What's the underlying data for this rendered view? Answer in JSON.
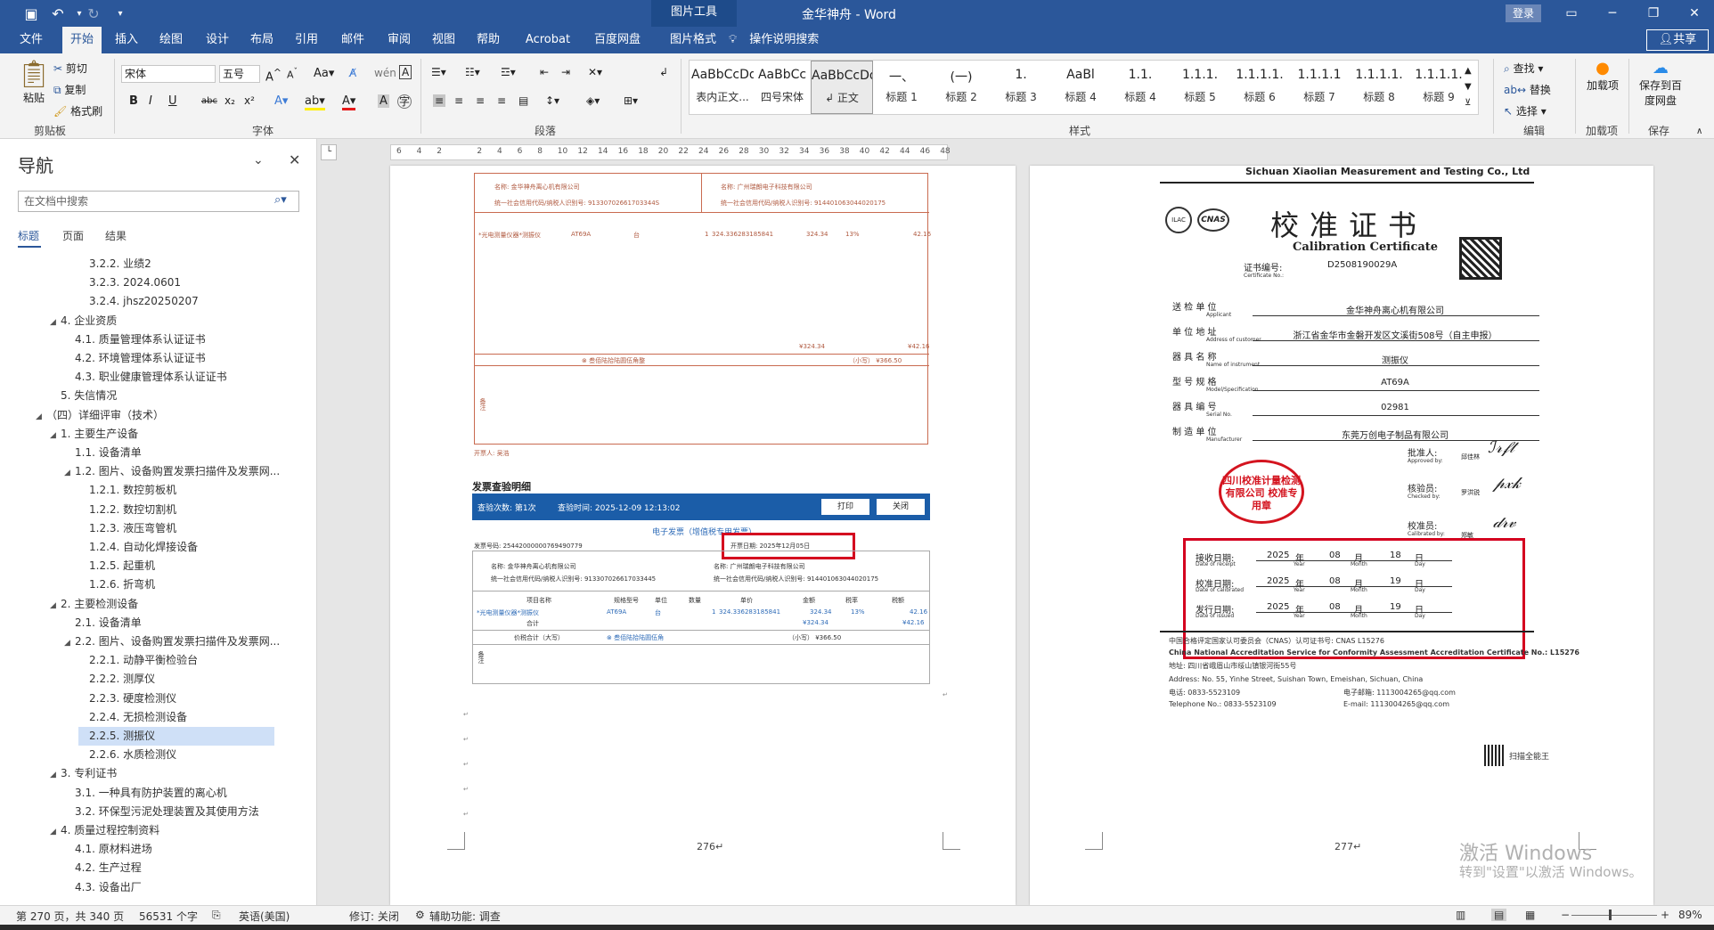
{
  "titlebar": {
    "context_tab": "图片工具",
    "doc_title": "金华神舟  -  Word",
    "login": "登录",
    "icons": [
      "save-icon",
      "undo-icon",
      "redo-icon",
      "customize-icon",
      "ribbon-display-icon",
      "minimize-icon",
      "restore-icon",
      "close-icon"
    ]
  },
  "tabs": [
    "文件",
    "开始",
    "插入",
    "绘图",
    "设计",
    "布局",
    "引用",
    "邮件",
    "审阅",
    "视图",
    "帮助",
    "Acrobat",
    "百度网盘",
    "图片格式"
  ],
  "active_tab": "开始",
  "tell_me": "操作说明搜索",
  "share": "共享",
  "ribbon": {
    "clipboard": {
      "paste": "粘贴",
      "cut": "剪切",
      "copy": "复制",
      "format_painter": "格式刷",
      "label": "剪贴板"
    },
    "font": {
      "name": "宋体",
      "size": "五号",
      "label": "字体",
      "buttons": [
        "B",
        "I",
        "U",
        "abc",
        "x₂",
        "x²",
        "A",
        "Aa"
      ]
    },
    "paragraph": {
      "label": "段落"
    },
    "styles": {
      "label": "样式",
      "items": [
        {
          "preview": "AaBbCcDd",
          "name": "表内正文..."
        },
        {
          "preview": "AaBbCc",
          "name": "四号宋体"
        },
        {
          "preview": "AaBbCcDdI",
          "name": "↲ 正文"
        },
        {
          "preview": "一、",
          "name": "标题 1"
        },
        {
          "preview": "(一)",
          "name": "标题 2"
        },
        {
          "preview": "1.",
          "name": "标题 3"
        },
        {
          "preview": "AaBl",
          "name": "标题 4"
        },
        {
          "preview": "1.1.",
          "name": "标题 4"
        },
        {
          "preview": "1.1.1.",
          "name": "标题 5"
        },
        {
          "preview": "1.1.1.1.",
          "name": "标题 6"
        },
        {
          "preview": "1.1.1.1",
          "name": "标题 7"
        },
        {
          "preview": "1.1.1.1.",
          "name": "标题 8"
        },
        {
          "preview": "1.1.1.1.",
          "name": "标题 9"
        }
      ]
    },
    "editing": {
      "find": "查找",
      "replace": "替换",
      "select": "选择",
      "label": "编辑"
    },
    "addin": {
      "btn": "加载项",
      "label": "加载项"
    },
    "save": {
      "btn": "保存到百度网盘",
      "label": "保存"
    }
  },
  "nav": {
    "title": "导航",
    "search_placeholder": "在文档中搜索",
    "tabs": [
      "标题",
      "页面",
      "结果"
    ],
    "items": [
      {
        "text": "3.2.2. 业绩2",
        "indent": 3,
        "tri": ""
      },
      {
        "text": "3.2.3. 2024.0601",
        "indent": 3,
        "tri": ""
      },
      {
        "text": "3.2.4. jhsz20250207",
        "indent": 3,
        "tri": ""
      },
      {
        "text": "4. 企业资质",
        "indent": 1,
        "tri": "◢"
      },
      {
        "text": "4.1. 质量管理体系认证证书",
        "indent": 2,
        "tri": ""
      },
      {
        "text": "4.2. 环境管理体系认证证书",
        "indent": 2,
        "tri": ""
      },
      {
        "text": "4.3. 职业健康管理体系认证证书",
        "indent": 2,
        "tri": ""
      },
      {
        "text": "5. 失信情况",
        "indent": 1,
        "tri": ""
      },
      {
        "text": "（四）详细评审（技术）",
        "indent": 0,
        "tri": "◢"
      },
      {
        "text": "1. 主要生产设备",
        "indent": 1,
        "tri": "◢"
      },
      {
        "text": "1.1. 设备清单",
        "indent": 2,
        "tri": ""
      },
      {
        "text": "1.2. 图片、设备购置发票扫描件及发票网...",
        "indent": 2,
        "tri": "◢"
      },
      {
        "text": "1.2.1. 数控剪板机",
        "indent": 3,
        "tri": ""
      },
      {
        "text": "1.2.2. 数控切割机",
        "indent": 3,
        "tri": ""
      },
      {
        "text": "1.2.3. 液压弯管机",
        "indent": 3,
        "tri": ""
      },
      {
        "text": "1.2.4. 自动化焊接设备",
        "indent": 3,
        "tri": ""
      },
      {
        "text": "1.2.5. 起重机",
        "indent": 3,
        "tri": ""
      },
      {
        "text": "1.2.6. 折弯机",
        "indent": 3,
        "tri": ""
      },
      {
        "text": "2. 主要检测设备",
        "indent": 1,
        "tri": "◢"
      },
      {
        "text": "2.1. 设备清单",
        "indent": 2,
        "tri": ""
      },
      {
        "text": "2.2. 图片、设备购置发票扫描件及发票网...",
        "indent": 2,
        "tri": "◢"
      },
      {
        "text": "2.2.1. 动静平衡检验台",
        "indent": 3,
        "tri": ""
      },
      {
        "text": "2.2.2. 测厚仪",
        "indent": 3,
        "tri": ""
      },
      {
        "text": "2.2.3. 硬度检测仪",
        "indent": 3,
        "tri": ""
      },
      {
        "text": "2.2.4. 无损检测设备",
        "indent": 3,
        "tri": ""
      },
      {
        "text": "2.2.5. 测振仪",
        "indent": 3,
        "tri": "",
        "selected": true
      },
      {
        "text": "2.2.6. 水质检测仪",
        "indent": 3,
        "tri": ""
      },
      {
        "text": "3. 专利证书",
        "indent": 1,
        "tri": "◢"
      },
      {
        "text": "3.1. 一种具有防护装置的离心机",
        "indent": 2,
        "tri": ""
      },
      {
        "text": "3.2. 环保型污泥处理装置及其使用方法",
        "indent": 2,
        "tri": ""
      },
      {
        "text": "4. 质量过程控制资料",
        "indent": 1,
        "tri": "◢"
      },
      {
        "text": "4.1. 原材料进场",
        "indent": 2,
        "tri": ""
      },
      {
        "text": "4.2. 生产过程",
        "indent": 2,
        "tri": ""
      },
      {
        "text": "4.3. 设备出厂",
        "indent": 2,
        "tri": ""
      }
    ]
  },
  "ruler": {
    "ticks": [
      "6",
      "4",
      "2",
      "",
      "2",
      "4",
      "6",
      "8",
      "10",
      "12",
      "14",
      "16",
      "18",
      "20",
      "22",
      "24",
      "26",
      "28",
      "30",
      "32",
      "34",
      "36",
      "38",
      "40",
      "42",
      "44",
      "46",
      "48"
    ]
  },
  "page276": {
    "page_num": "276↵",
    "invoice_top": {
      "buyer_name": "名称: 金华神舟离心机有限公司",
      "buyer_tax": "统一社会信用代码/纳税人识别号: 91330702661703344S",
      "seller_name": "名称: 广州瑞朗电子科技有限公司",
      "seller_tax": "统一社会信用代码/纳税人识别号: 914401063044020175",
      "item": "*光电测量仪器*测振仪",
      "model": "AT69A",
      "unit": "台",
      "qty": "1",
      "price": "324.336283185841",
      "amount": "324.34",
      "rate": "13%",
      "tax": "42.16",
      "total_amount": "¥324.34",
      "total_tax": "¥42.16",
      "total_words": "⊗ 叁佰陆拾陆圆伍角整",
      "total_small": "（小写） ¥366.50",
      "remark_label": "备注",
      "issuer": "开票人: 吴浩"
    },
    "check_title": "发票查验明细",
    "check_bar": {
      "count": "查验次数: 第1次",
      "time": "查验时间: 2025-12-09 12:13:02",
      "print": "打印",
      "close": "关闭"
    },
    "einv_title": "电子发票（增值税专用发票）",
    "einv": {
      "number": "发票号码: 25442000000769490779",
      "date": "开票日期: 2025年12月05日",
      "buyer_name": "名称:  金华神舟离心机有限公司",
      "buyer_tax": "统一社会信用代码/纳税人识别号:  913307026617033445",
      "seller_name": "名称:  广州瑞朗电子科技有限公司",
      "seller_tax": "统一社会信用代码/纳税人识别号:  914401063044020175",
      "headers": [
        "项目名称",
        "规格型号",
        "单位",
        "数量",
        "单价",
        "金额",
        "税率",
        "税额"
      ],
      "row": [
        "*光电测量仪器*测振仪",
        "AT69A",
        "台",
        "1",
        "324.336283185841",
        "324.34",
        "13%",
        "42.16"
      ],
      "sum_label": "合计",
      "sum_amount": "¥324.34",
      "sum_tax": "¥42.16",
      "total_label": "价税合计（大写）",
      "total_words": "⊗ 叁佰陆拾陆圆伍角",
      "total_small": "（小写）  ¥366.50",
      "remark": "备注"
    }
  },
  "page277": {
    "page_num": "277↵",
    "company": "Sichuan Xiaolian Measurement and Testing Co., Ltd",
    "title": "校准证书",
    "title_en": "Calibration Certificate",
    "cert_no_label": "证书编号:",
    "cert_no_en": "Certificate No.:",
    "cert_no": "D2508190029A",
    "rows": [
      {
        "label": "送  检  单  位",
        "en": "Applicant",
        "value": "金华神舟离心机有限公司"
      },
      {
        "label": "单  位  地  址",
        "en": "Address of customer",
        "value": "浙江省金华市金磐开发区文溪街508号（自主申报）"
      },
      {
        "label": "器  具  名  称",
        "en": "Name of instrument",
        "value": "测振仪"
      },
      {
        "label": "型  号  规  格",
        "en": "Model/Specification",
        "value": "AT69A"
      },
      {
        "label": "器  具  编  号",
        "en": "Serial No.",
        "value": "02981"
      },
      {
        "label": "制  造  单  位",
        "en": "Manufacturer",
        "value": "东莞万创电子制品有限公司"
      }
    ],
    "approver": {
      "label": "批准人:",
      "en": "Approved by:",
      "name": "邱佳林"
    },
    "checker": {
      "label": "核验员:",
      "en": "Checked by:",
      "name": "罗洪锐"
    },
    "calibrator": {
      "label": "校准员:",
      "en": "Calibrated by:",
      "name": "郑敏"
    },
    "seal": "四川校准计量检测有限公司 校准专用章",
    "dates": [
      {
        "label": "接收日期:",
        "en": "Date of receipt",
        "y": "2025",
        "m": "08",
        "d": "18"
      },
      {
        "label": "校准日期:",
        "en": "Date of calibrated",
        "y": "2025",
        "m": "08",
        "d": "19"
      },
      {
        "label": "发行日期:",
        "en": "Date of issued",
        "y": "2025",
        "m": "08",
        "d": "19"
      }
    ],
    "date_units": {
      "y": "年",
      "y_en": "Year",
      "m": "月",
      "m_en": "Month",
      "d": "日",
      "d_en": "Day"
    },
    "footer": [
      "中国合格评定国家认可委员会（CNAS）认可证书号: CNAS L15276",
      "China National Accreditation Service for Conformity Assessment Accreditation Certificate No.: L15276",
      "地址: 四川省峨眉山市绥山镇银河街55号",
      "Address: No. 55, Yinhe Street, Suishan Town, Emeishan, Sichuan, China",
      "电话: 0833-5523109",
      "电子邮箱: 1113004265@qq.com",
      "Telephone No.: 0833-5523109",
      "E-mail: 1113004265@qq.com"
    ],
    "scanner": "扫描全能王"
  },
  "watermark": {
    "line1": "激活 Windows",
    "line2": "转到\"设置\"以激活 Windows。"
  },
  "status": {
    "page": "第 270 页，共 340 页",
    "words": "56531 个字",
    "lang": "英语(美国)",
    "track": "修订: 关闭",
    "access": "辅助功能: 调查",
    "zoom": "89%"
  }
}
